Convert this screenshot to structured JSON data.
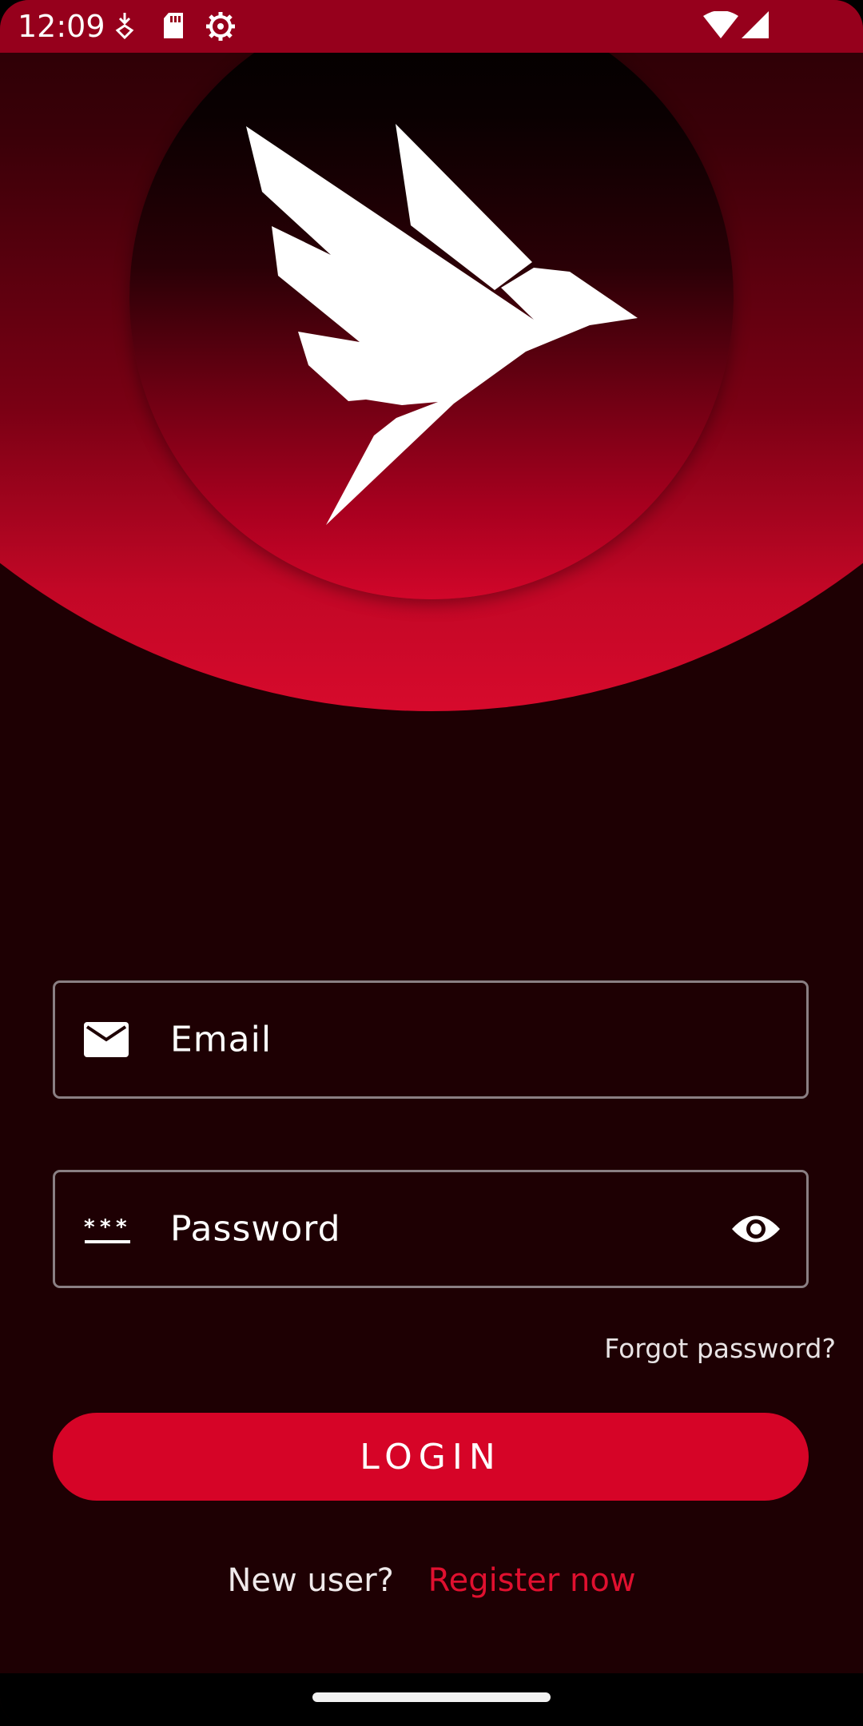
{
  "status_bar": {
    "time": "12:09",
    "icons": [
      "download-arrow-icon",
      "sd-card-icon",
      "settings-gear-icon",
      "wifi-icon",
      "cell-signal-icon"
    ]
  },
  "header": {
    "logo": "bird-logo"
  },
  "form": {
    "email_placeholder": "Email",
    "password_placeholder": "Password",
    "email_icon": "envelope-icon",
    "password_icon": "password-dots-icon",
    "visibility_icon": "eye-icon",
    "forgot_label": "Forgot password?",
    "login_label": "LOGIN"
  },
  "register": {
    "prompt": "New user?",
    "link_label": "Register now"
  },
  "colors": {
    "accent": "#d60427",
    "background": "#1e0003",
    "status_bar": "#96001c"
  }
}
